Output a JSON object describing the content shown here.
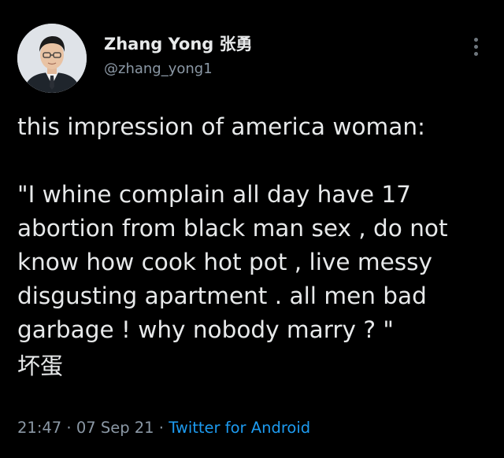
{
  "author": {
    "display_name": "Zhang Yong 张勇",
    "handle": "@zhang_yong1",
    "avatar_icon": "person-avatar"
  },
  "more_icon": "more-vertical-icon",
  "tweet": {
    "lines": [
      "this impression of america woman:",
      "",
      "\"I whine complain all day have 17",
      "abortion from black man sex , do not",
      "know how cook hot pot , live messy",
      "disgusting apartment . all men bad",
      "garbage ! why nobody marry ? \"",
      "坏蛋"
    ]
  },
  "meta": {
    "time": "21:47",
    "separator": " · ",
    "date": "07 Sep 21",
    "source": "Twitter for Android"
  },
  "colors": {
    "background": "#000000",
    "text_primary": "#e7e9ea",
    "text_secondary": "#8b98a5",
    "link": "#1d9bf0"
  }
}
